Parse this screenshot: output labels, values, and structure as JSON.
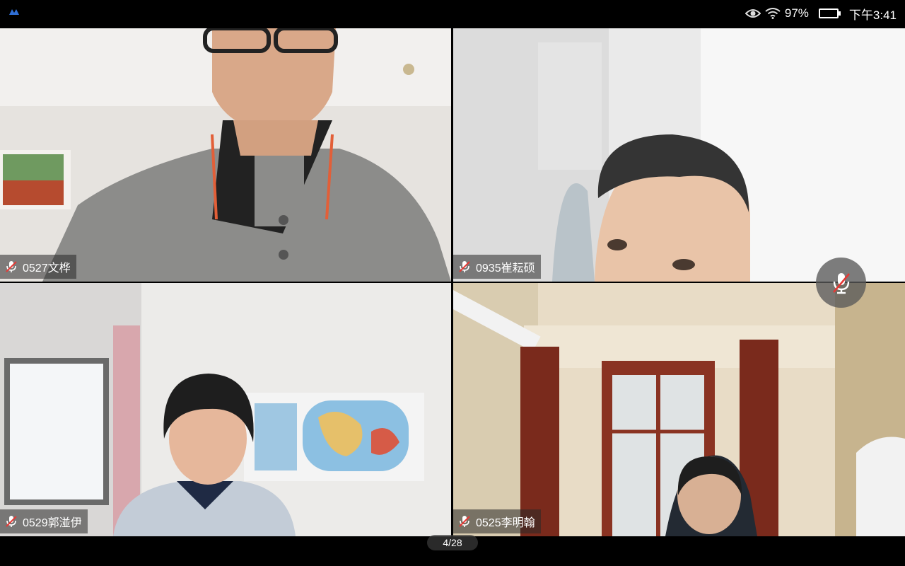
{
  "status_bar": {
    "battery_percent": "97%",
    "time": "下午3:41",
    "battery_level": 0.97,
    "battery_color": "#3fc24a",
    "icons": [
      "app-icon",
      "eye-icon",
      "wifi-icon",
      "battery-icon"
    ]
  },
  "participants": [
    {
      "name": "0527文桦",
      "mic_muted": true
    },
    {
      "name": "0935崔耘硕",
      "mic_muted": true
    },
    {
      "name": "0529郭湴伊",
      "mic_muted": true
    },
    {
      "name": "0525李明翰",
      "mic_muted": true
    }
  ],
  "controls": {
    "mute_button_icon": "mic-muted-icon"
  },
  "pager": {
    "label": "4/28"
  },
  "colors": {
    "muted_slash": "#e53935",
    "badge_bg": "rgba(40,40,40,0.55)"
  }
}
